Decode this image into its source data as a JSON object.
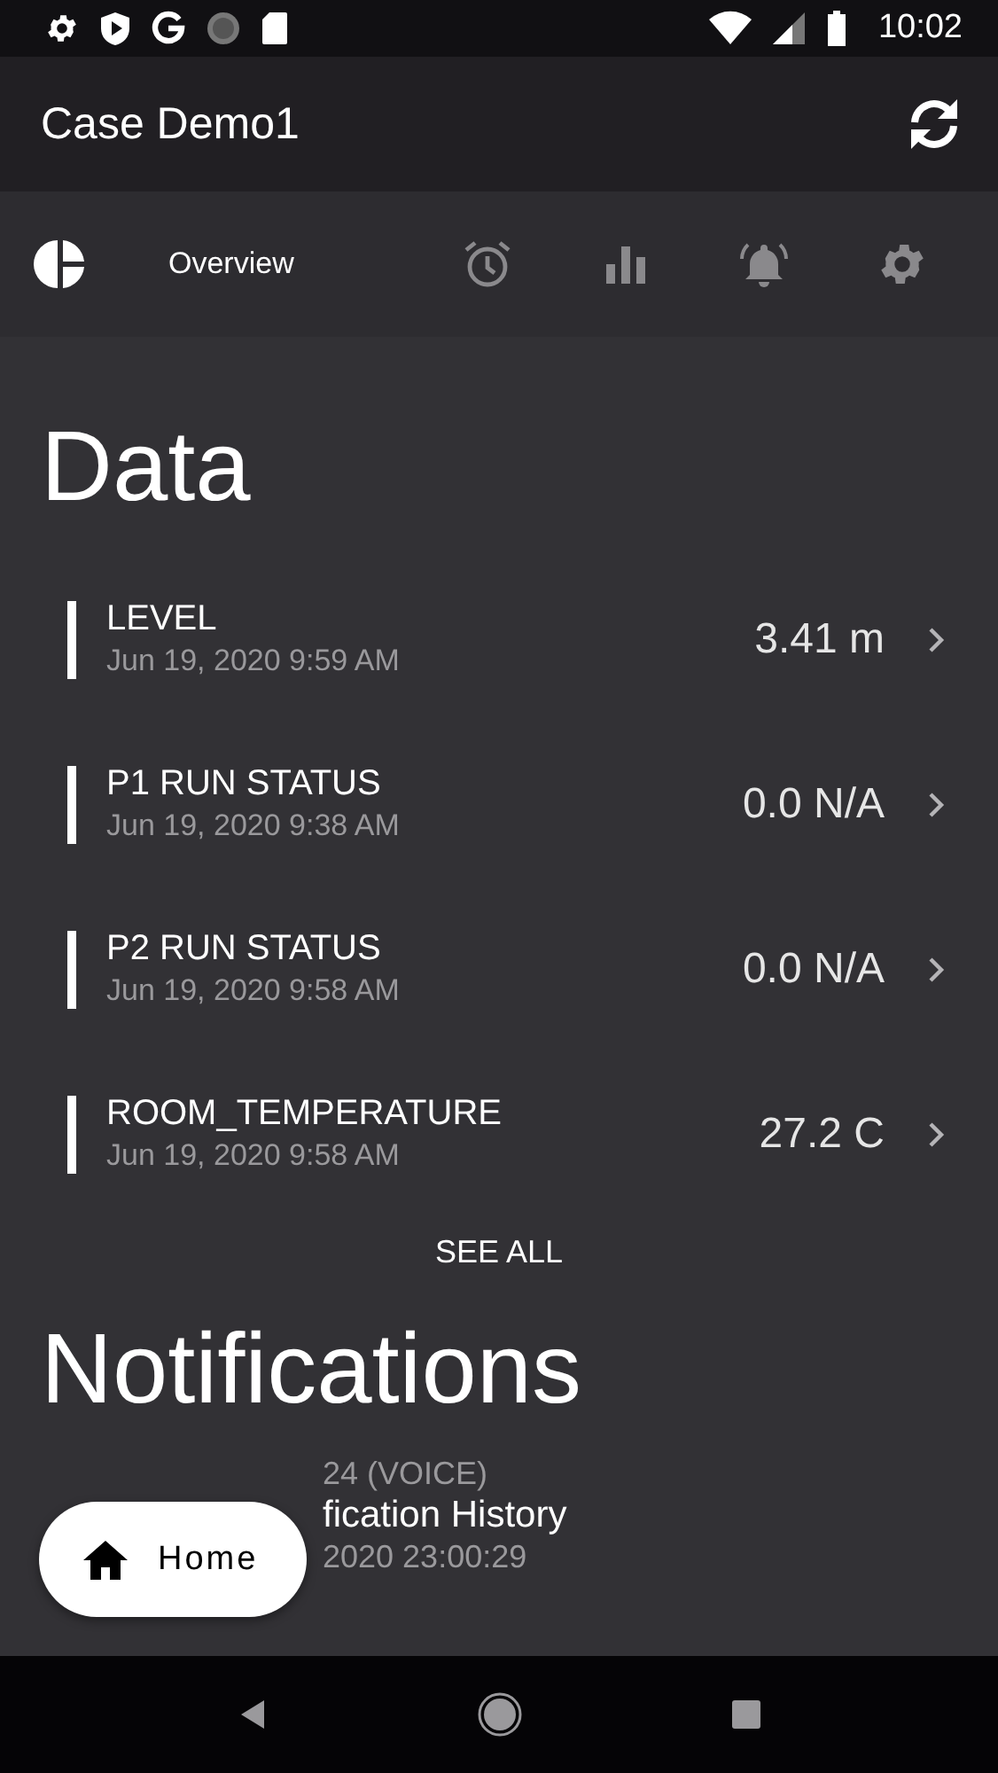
{
  "status_bar": {
    "time": "10:02"
  },
  "app_bar": {
    "title": "Case Demo1"
  },
  "tabs": [
    {
      "kind": "pie",
      "label": "Overview",
      "selected": true
    },
    {
      "kind": "alarm",
      "selected": false
    },
    {
      "kind": "chart",
      "selected": false
    },
    {
      "kind": "bell",
      "selected": false
    },
    {
      "kind": "gear",
      "selected": false
    }
  ],
  "data": {
    "title": "Data",
    "items": [
      {
        "name": "LEVEL",
        "time": "Jun 19, 2020 9:59 AM",
        "value": "3.41 m"
      },
      {
        "name": "P1 RUN STATUS",
        "time": "Jun 19, 2020 9:38 AM",
        "value": "0.0 N/A"
      },
      {
        "name": "P2 RUN STATUS",
        "time": "Jun 19, 2020 9:58 AM",
        "value": "0.0 N/A"
      },
      {
        "name": "ROOM_TEMPERATURE",
        "time": "Jun 19, 2020 9:58 AM",
        "value": "27.2 C"
      }
    ],
    "see_all": "SEE ALL"
  },
  "notifications": {
    "title": "Notifications",
    "items": [
      {
        "source": "24 (VOICE)",
        "title": "fication History",
        "time": "2020 23:00:29"
      }
    ]
  },
  "home_button": {
    "label": "Home"
  }
}
